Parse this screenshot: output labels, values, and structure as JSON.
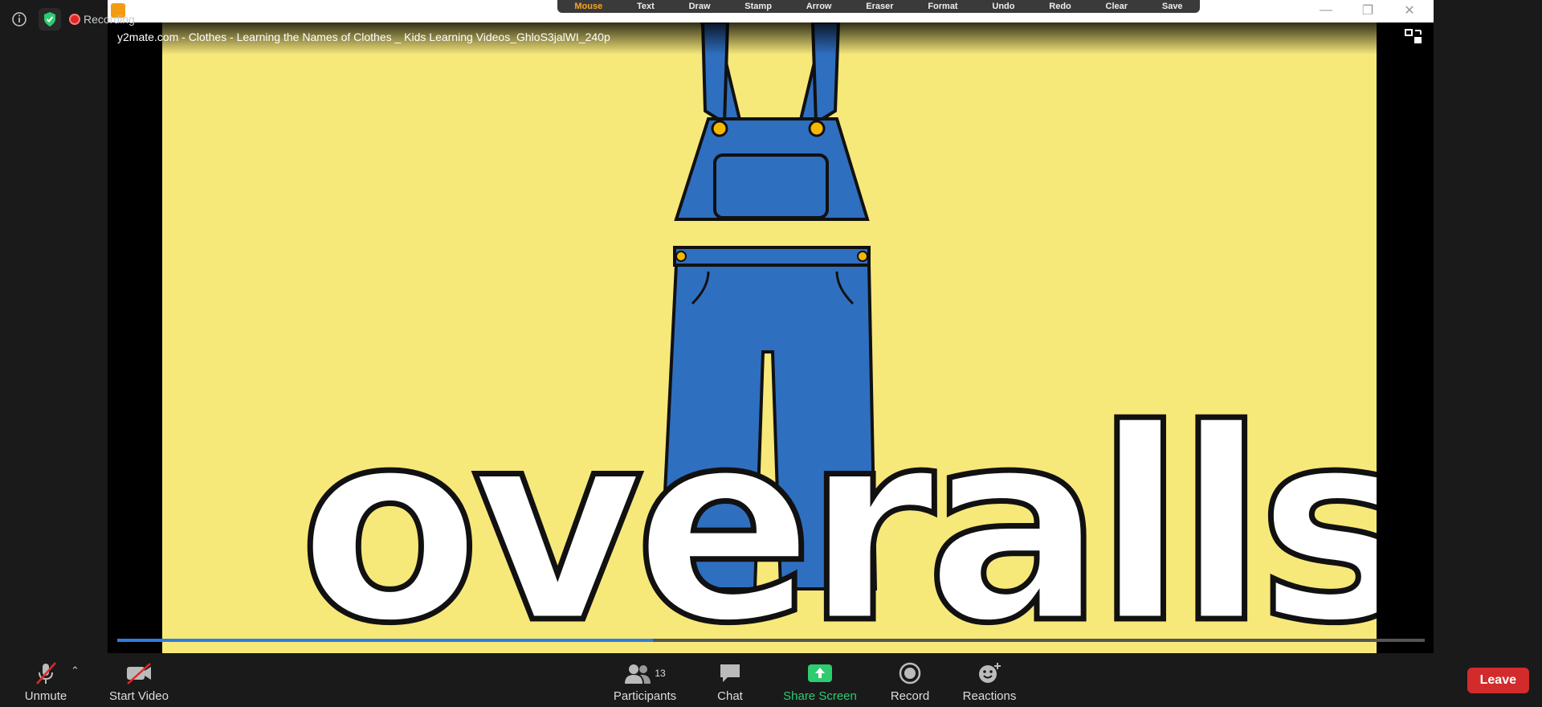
{
  "window": {
    "video_title": "y2mate.com - Clothes - Learning the Names of Clothes _ Kids Learning Videos_GhloS3jalWI_240p",
    "recording_label": "Recording",
    "video_word": "overalls",
    "playback_progress": 0.41
  },
  "annotation_toolbar": {
    "items": [
      "Mouse",
      "Text",
      "Draw",
      "Stamp",
      "Arrow",
      "Eraser",
      "Format",
      "Undo",
      "Redo",
      "Clear",
      "Save"
    ],
    "active": "Mouse"
  },
  "toolbar": {
    "unmute_label": "Unmute",
    "start_video_label": "Start Video",
    "participants_label": "Participants",
    "participants_count": "13",
    "chat_label": "Chat",
    "share_screen_label": "Share Screen",
    "record_label": "Record",
    "reactions_label": "Reactions",
    "leave_label": "Leave"
  },
  "colors": {
    "accent_share": "#2ecc71",
    "leave": "#d22b2b",
    "video_bg": "#f7e87a",
    "overalls": "#2f6fc0"
  }
}
